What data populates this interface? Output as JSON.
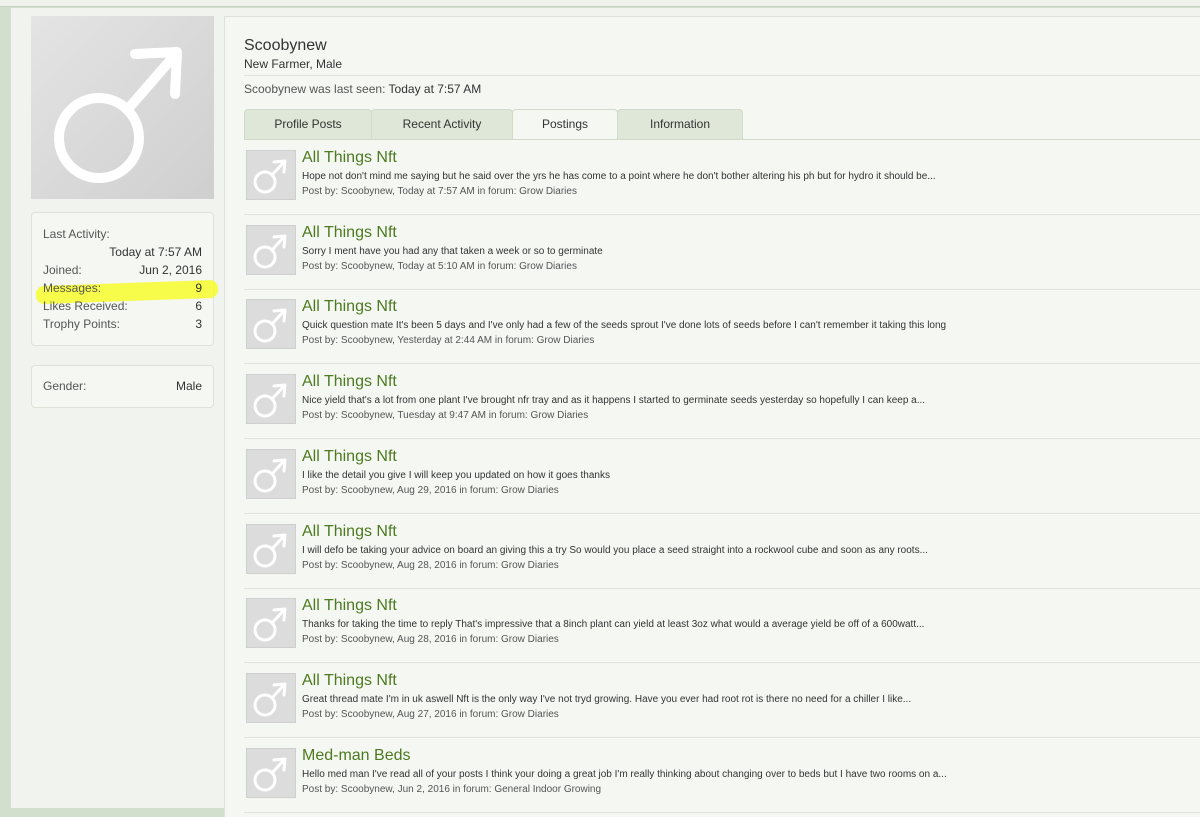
{
  "icons": {
    "avatar": "male-symbol-icon"
  },
  "colors": {
    "accent_green": "#4d7a1f",
    "highlight": "#f7fb2a",
    "tab_bg": "#dfe7d8"
  },
  "profile": {
    "username": "Scoobynew",
    "title": "New Farmer, Male",
    "last_seen_prefix": "Scoobynew was last seen:",
    "last_seen_value": "Today at 7:57 AM"
  },
  "stats": {
    "last_activity_label": "Last Activity:",
    "last_activity_value": "Today at 7:57 AM",
    "joined_label": "Joined:",
    "joined_value": "Jun 2, 2016",
    "messages_label": "Messages:",
    "messages_value": "9",
    "likes_label": "Likes Received:",
    "likes_value": "6",
    "trophy_label": "Trophy Points:",
    "trophy_value": "3"
  },
  "gender": {
    "label": "Gender:",
    "value": "Male"
  },
  "tabs": [
    {
      "label": "Profile Posts"
    },
    {
      "label": "Recent Activity"
    },
    {
      "label": "Postings"
    },
    {
      "label": "Information"
    }
  ],
  "posts": [
    {
      "title": "All Things Nft",
      "snippet": "Hope not don't mind me saying but he said over the yrs he has come to a point where he don't bother altering his ph but for hydro it should be...",
      "meta": "Post by: Scoobynew, Today at 7:57 AM in forum: Grow Diaries"
    },
    {
      "title": "All Things Nft",
      "snippet": "Sorry I ment have you had any that taken a week or so to germinate",
      "meta": "Post by: Scoobynew, Today at 5:10 AM in forum: Grow Diaries"
    },
    {
      "title": "All Things Nft",
      "snippet": "Quick question mate It's been 5 days and I've only had a few of the seeds sprout I've done lots of seeds before I can't remember it taking this long",
      "meta": "Post by: Scoobynew, Yesterday at 2:44 AM in forum: Grow Diaries"
    },
    {
      "title": "All Things Nft",
      "snippet": "Nice yield that's a lot from one plant I've brought nfr tray and as it happens I started to germinate seeds yesterday so hopefully I can keep a...",
      "meta": "Post by: Scoobynew, Tuesday at 9:47 AM in forum: Grow Diaries"
    },
    {
      "title": "All Things Nft",
      "snippet": "I like the detail you give I will keep you updated on how it goes thanks",
      "meta": "Post by: Scoobynew, Aug 29, 2016 in forum: Grow Diaries"
    },
    {
      "title": "All Things Nft",
      "snippet": "I will defo be taking your advice on board an giving this a try So would you place a seed straight into a rockwool cube and soon as any roots...",
      "meta": "Post by: Scoobynew, Aug 28, 2016 in forum: Grow Diaries"
    },
    {
      "title": "All Things Nft",
      "snippet": "Thanks for taking the time to reply That's impressive that a 8inch plant can yield at least 3oz what would a average yield be off of a 600watt...",
      "meta": "Post by: Scoobynew, Aug 28, 2016 in forum: Grow Diaries"
    },
    {
      "title": "All Things Nft",
      "snippet": "Great thread mate I'm in uk aswell Nft is the only way I've not tryd growing. Have you ever had root rot is there no need for a chiller I like...",
      "meta": "Post by: Scoobynew, Aug 27, 2016 in forum: Grow Diaries"
    },
    {
      "title": "Med-man Beds",
      "snippet": "Hello med man I've read all of your posts I think your doing a great job I'm really thinking about changing over to beds but I have two rooms on a...",
      "meta": "Post by: Scoobynew, Jun 2, 2016 in forum: General Indoor Growing"
    }
  ]
}
